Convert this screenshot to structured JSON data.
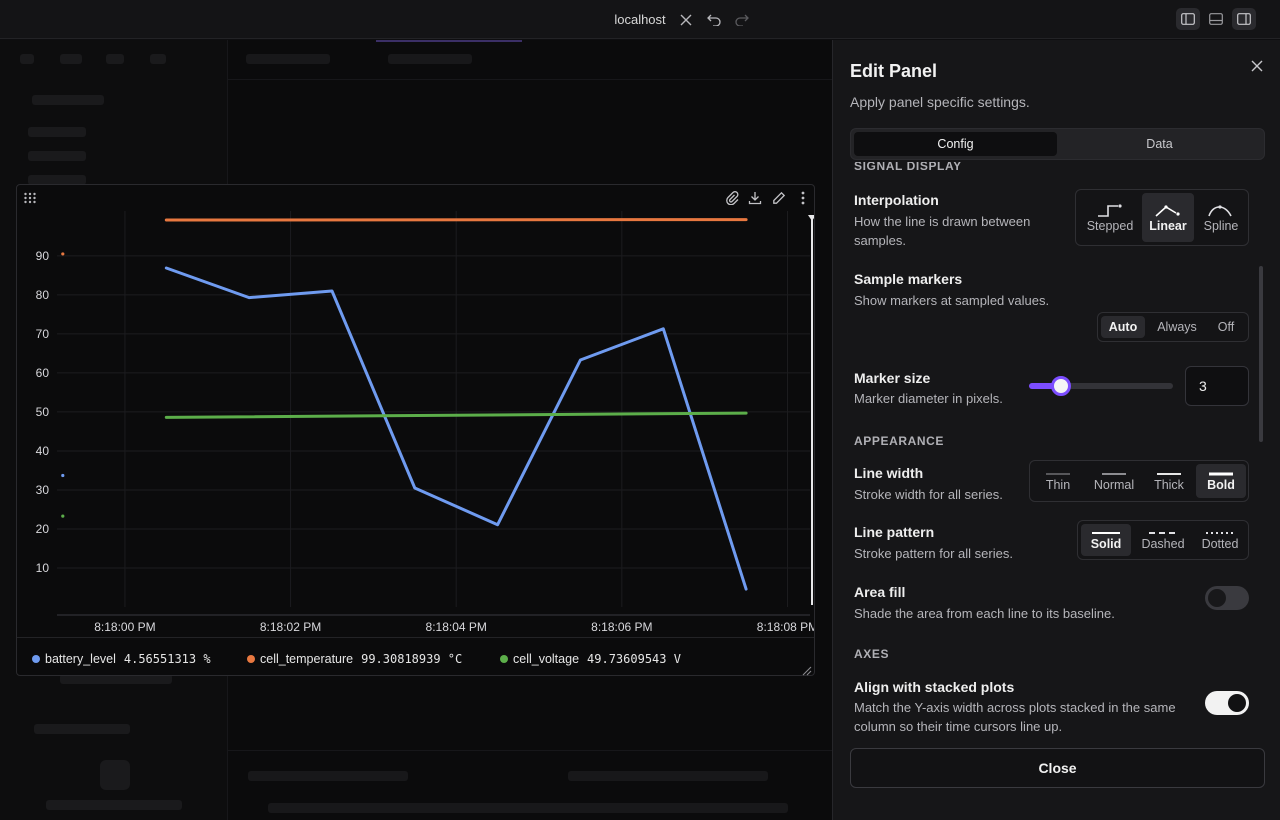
{
  "titlebar": {
    "host": "localhost"
  },
  "plot_panel": {
    "legend": [
      {
        "name": "battery_level",
        "value": "4.56551313 %",
        "color": "#6f9bf0"
      },
      {
        "name": "cell_temperature",
        "value": "99.30818939 °C",
        "color": "#e87840"
      },
      {
        "name": "cell_voltage",
        "value": "49.73609543 V",
        "color": "#5cae4a"
      }
    ]
  },
  "chart_data": {
    "type": "line",
    "y_ticks": [
      10,
      20,
      30,
      40,
      50,
      60,
      70,
      80,
      90
    ],
    "x_ticks": [
      "8:18:00 PM",
      "8:18:02 PM",
      "8:18:04 PM",
      "8:18:06 PM",
      "8:18:08 PM"
    ],
    "x_range_seconds": [
      -0.82,
      8.32
    ],
    "ylim": [
      0,
      101.5
    ],
    "grid": true,
    "series": [
      {
        "name": "battery_level",
        "color": "#6f9bf0",
        "x": [
          0.5,
          1.5,
          2.5,
          3.5,
          4.5,
          5.5,
          6.5,
          7.5
        ],
        "y": [
          86.9,
          79.3,
          81.0,
          30.5,
          21.1,
          63.3,
          71.3,
          4.6
        ]
      },
      {
        "name": "cell_temperature",
        "color": "#e87840",
        "x": [
          0.5,
          7.5
        ],
        "y": [
          99.2,
          99.3
        ]
      },
      {
        "name": "cell_voltage",
        "color": "#5cae4a",
        "x": [
          0.5,
          7.5
        ],
        "y": [
          48.6,
          49.7
        ]
      }
    ],
    "marker_points": [
      {
        "x": -0.75,
        "y": 90.5,
        "color": "#e87840"
      },
      {
        "x": -0.75,
        "y": 33.7,
        "color": "#6f9bf0"
      },
      {
        "x": -0.75,
        "y": 23.3,
        "color": "#5cae4a"
      }
    ]
  },
  "edit_panel": {
    "title": "Edit Panel",
    "subtitle": "Apply panel specific settings.",
    "tabs": [
      {
        "label": "Config",
        "active": true
      },
      {
        "label": "Data",
        "active": false
      }
    ],
    "sections": {
      "signal_display": "SIGNAL DISPLAY",
      "appearance": "APPEARANCE",
      "axes": "AXES"
    },
    "interpolation": {
      "label": "Interpolation",
      "desc": "How the line is drawn between samples.",
      "options": [
        "Stepped",
        "Linear",
        "Spline"
      ],
      "selected": "Linear"
    },
    "sample_markers": {
      "label": "Sample markers",
      "desc": "Show markers at sampled values.",
      "options": [
        "Auto",
        "Always",
        "Off"
      ],
      "selected": "Auto"
    },
    "marker_size": {
      "label": "Marker size",
      "desc": "Marker diameter in pixels.",
      "value": "3",
      "slider_fraction": 0.22
    },
    "line_width": {
      "label": "Line width",
      "desc": "Stroke width for all series.",
      "options": [
        "Thin",
        "Normal",
        "Thick",
        "Bold"
      ],
      "selected": "Bold"
    },
    "line_pattern": {
      "label": "Line pattern",
      "desc": "Stroke pattern for all series.",
      "options": [
        "Solid",
        "Dashed",
        "Dotted"
      ],
      "selected": "Solid"
    },
    "area_fill": {
      "label": "Area fill",
      "desc": "Shade the area from each line to its baseline.",
      "enabled": false
    },
    "align_stacked": {
      "label": "Align with stacked plots",
      "desc": "Match the Y-axis width across plots stacked in the same column so their time cursors line up.",
      "enabled": true
    },
    "close_label": "Close"
  },
  "colors": {
    "accent": "#7c4dff"
  }
}
